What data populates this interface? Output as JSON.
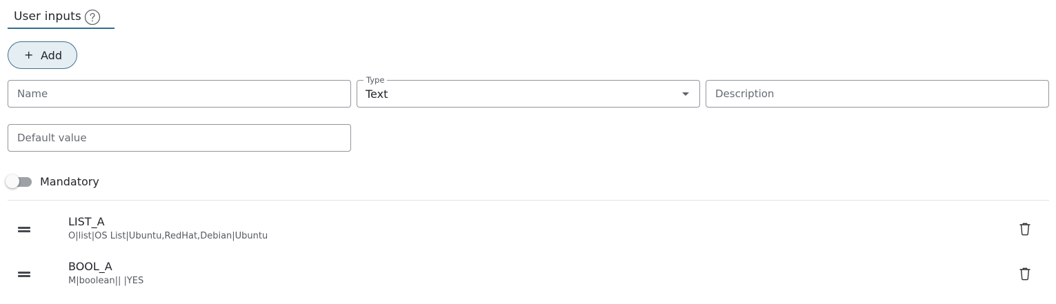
{
  "tab": {
    "label": "User inputs",
    "help_icon": "help-circle-icon"
  },
  "add_button": {
    "icon": "plus-icon",
    "label": "Add"
  },
  "form": {
    "name": {
      "placeholder": "Name",
      "value": ""
    },
    "type": {
      "label": "Type",
      "value": "Text",
      "icon": "caret-down-icon"
    },
    "description": {
      "placeholder": "Description",
      "value": ""
    },
    "default_value": {
      "placeholder": "Default value",
      "value": ""
    },
    "mandatory": {
      "label": "Mandatory",
      "checked": false
    }
  },
  "inputs": [
    {
      "title": "LIST_A",
      "detail": "O|list|OS List|Ubuntu,RedHat,Debian|Ubuntu",
      "drag_icon": "drag-handle-icon",
      "delete_icon": "trash-icon"
    },
    {
      "title": "BOOL_A",
      "detail": "M|boolean|| |YES",
      "drag_icon": "drag-handle-icon",
      "delete_icon": "trash-icon"
    }
  ],
  "colors": {
    "accent": "#2f6f8f",
    "add_button_bg": "#e5eef3",
    "add_button_border": "#3e6f8a",
    "toggle_track_off": "#9ea2a6"
  }
}
